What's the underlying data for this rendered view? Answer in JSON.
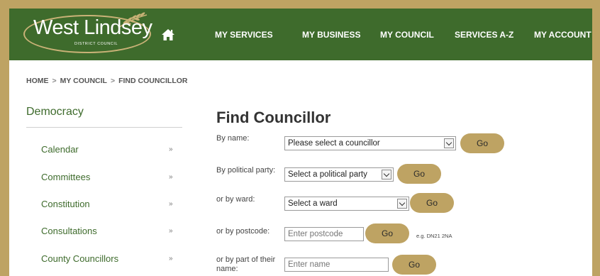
{
  "logo": {
    "name": "West Lindsey",
    "sub": "DISTRICT COUNCIL",
    "icon": "wheat-icon"
  },
  "nav": {
    "home_icon": "home-icon",
    "items": [
      {
        "label": "MY SERVICES"
      },
      {
        "label": "MY BUSINESS"
      },
      {
        "label": "MY COUNCIL"
      },
      {
        "label": "SERVICES A-Z"
      },
      {
        "label": "MY ACCOUNT"
      }
    ]
  },
  "breadcrumb": {
    "items": [
      "HOME",
      "MY COUNCIL",
      "FIND COUNCILLOR"
    ],
    "separator": ">"
  },
  "sidebar": {
    "title": "Democracy",
    "arrow": "»",
    "items": [
      {
        "label": "Calendar"
      },
      {
        "label": "Committees"
      },
      {
        "label": "Constitution"
      },
      {
        "label": "Consultations"
      },
      {
        "label": "County Councillors"
      }
    ]
  },
  "main": {
    "title": "Find Councillor",
    "go_label": "Go",
    "by_name": {
      "label": "By name:",
      "value": "Please select a councillor"
    },
    "by_party": {
      "label": "By political party:",
      "value": "Select a political party"
    },
    "by_ward": {
      "label": "or by ward:",
      "value": "Select a ward"
    },
    "by_postcode": {
      "label": "or by postcode:",
      "placeholder": "Enter postcode",
      "hint": "e.g. DN21 2NA"
    },
    "by_part_name": {
      "label": "or by part of their name:",
      "placeholder": "Enter name"
    }
  },
  "colors": {
    "brand_green": "#3e6b2c",
    "gold": "#bea363"
  }
}
